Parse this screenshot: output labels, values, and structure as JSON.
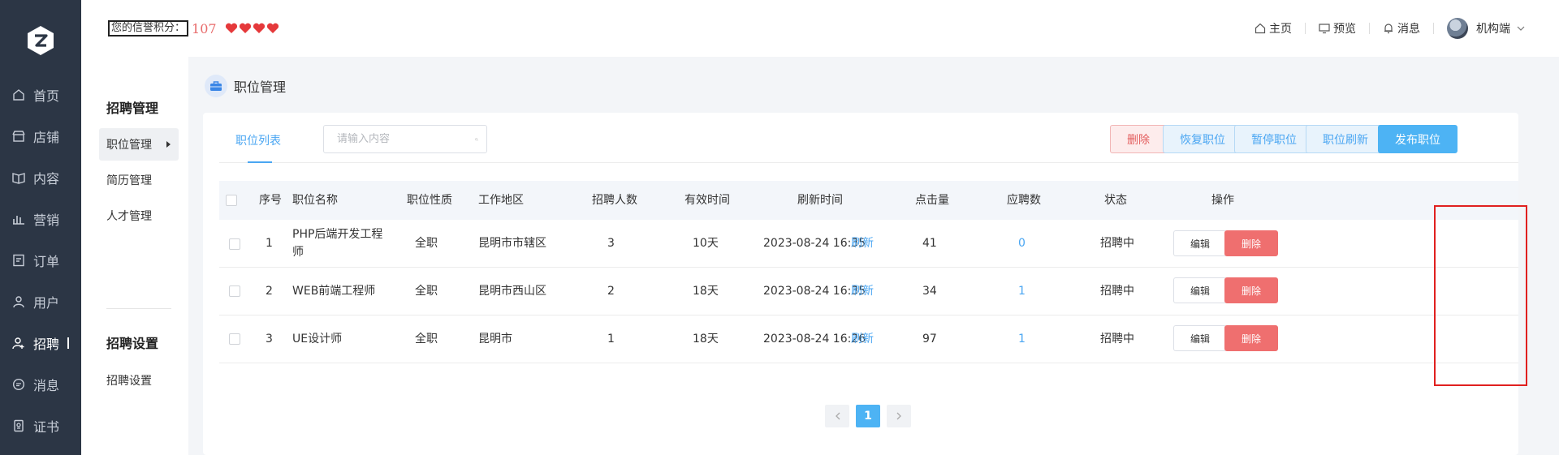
{
  "sidebar": {
    "items": [
      {
        "label": "首页",
        "icon": "home-icon"
      },
      {
        "label": "店铺",
        "icon": "shop-icon"
      },
      {
        "label": "内容",
        "icon": "book-icon"
      },
      {
        "label": "营销",
        "icon": "chart-icon"
      },
      {
        "label": "订单",
        "icon": "document-icon"
      },
      {
        "label": "用户",
        "icon": "user-icon"
      },
      {
        "label": "招聘",
        "icon": "user-add-icon"
      },
      {
        "label": "消息",
        "icon": "message-icon"
      },
      {
        "label": "证书",
        "icon": "certificate-icon"
      }
    ]
  },
  "header": {
    "credit_label": "您的信誉积分：",
    "credit_score": "107",
    "hearts": 4,
    "home": "主页",
    "preview": "预览",
    "messages": "消息",
    "user": "机构端"
  },
  "subnav": {
    "section1": "招聘管理",
    "items1": [
      "职位管理",
      "简历管理",
      "人才管理"
    ],
    "section2": "招聘设置",
    "items2": [
      "招聘设置"
    ]
  },
  "page": {
    "title": "职位管理"
  },
  "toolbar": {
    "tab": "职位列表",
    "search_placeholder": "请输入内容",
    "delete": "删除",
    "restore": "恢复职位",
    "pause": "暂停职位",
    "refresh": "职位刷新",
    "publish": "发布职位"
  },
  "table": {
    "headers": [
      "序号",
      "职位名称",
      "职位性质",
      "工作地区",
      "招聘人数",
      "有效时间",
      "刷新时间",
      "点击量",
      "应聘数",
      "状态",
      "操作"
    ],
    "refresh_label": "刷新",
    "edit_label": "编辑",
    "delete_label": "删除",
    "rows": [
      {
        "no": "1",
        "name1": "PHP后端开发工程",
        "name2": "师",
        "type": "全职",
        "area": "昆明市市辖区",
        "count": "3",
        "valid": "10天",
        "time": "2023-08-24 16:35",
        "clicks": "41",
        "applies": "0",
        "status": "招聘中"
      },
      {
        "no": "2",
        "name1": "WEB前端工程师",
        "name2": "",
        "type": "全职",
        "area": "昆明市西山区",
        "count": "2",
        "valid": "18天",
        "time": "2023-08-24 16:35",
        "clicks": "34",
        "applies": "1",
        "status": "招聘中"
      },
      {
        "no": "3",
        "name1": "UE设计师",
        "name2": "",
        "type": "全职",
        "area": "昆明市",
        "count": "1",
        "valid": "18天",
        "time": "2023-08-24 16:26",
        "clicks": "97",
        "applies": "1",
        "status": "招聘中"
      }
    ]
  },
  "pagination": {
    "current": "1"
  },
  "colors": {
    "primary": "#4db3f4",
    "danger": "#ef6f6f",
    "sidebar": "#2c3645",
    "highlight": "#e0201f"
  }
}
